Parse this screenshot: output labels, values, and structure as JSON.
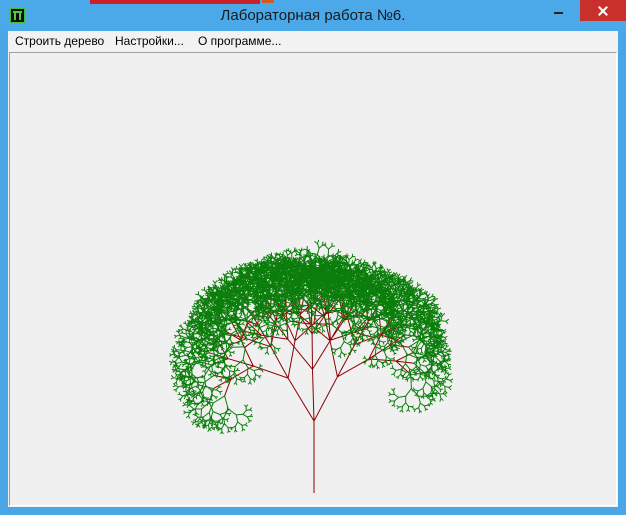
{
  "window": {
    "title": "Лабораторная работа №6.",
    "icon": "app-icon"
  },
  "menu": {
    "items": [
      {
        "label": "Строить дерево"
      },
      {
        "label": "Настройки..."
      },
      {
        "label": "О программе..."
      }
    ]
  },
  "colors": {
    "trunk": "#8b0000",
    "foliage": "#0b7d0b",
    "title_bar": "#4ba9ea",
    "close_button": "#c7302b",
    "canvas": "#f0f0f0"
  }
}
